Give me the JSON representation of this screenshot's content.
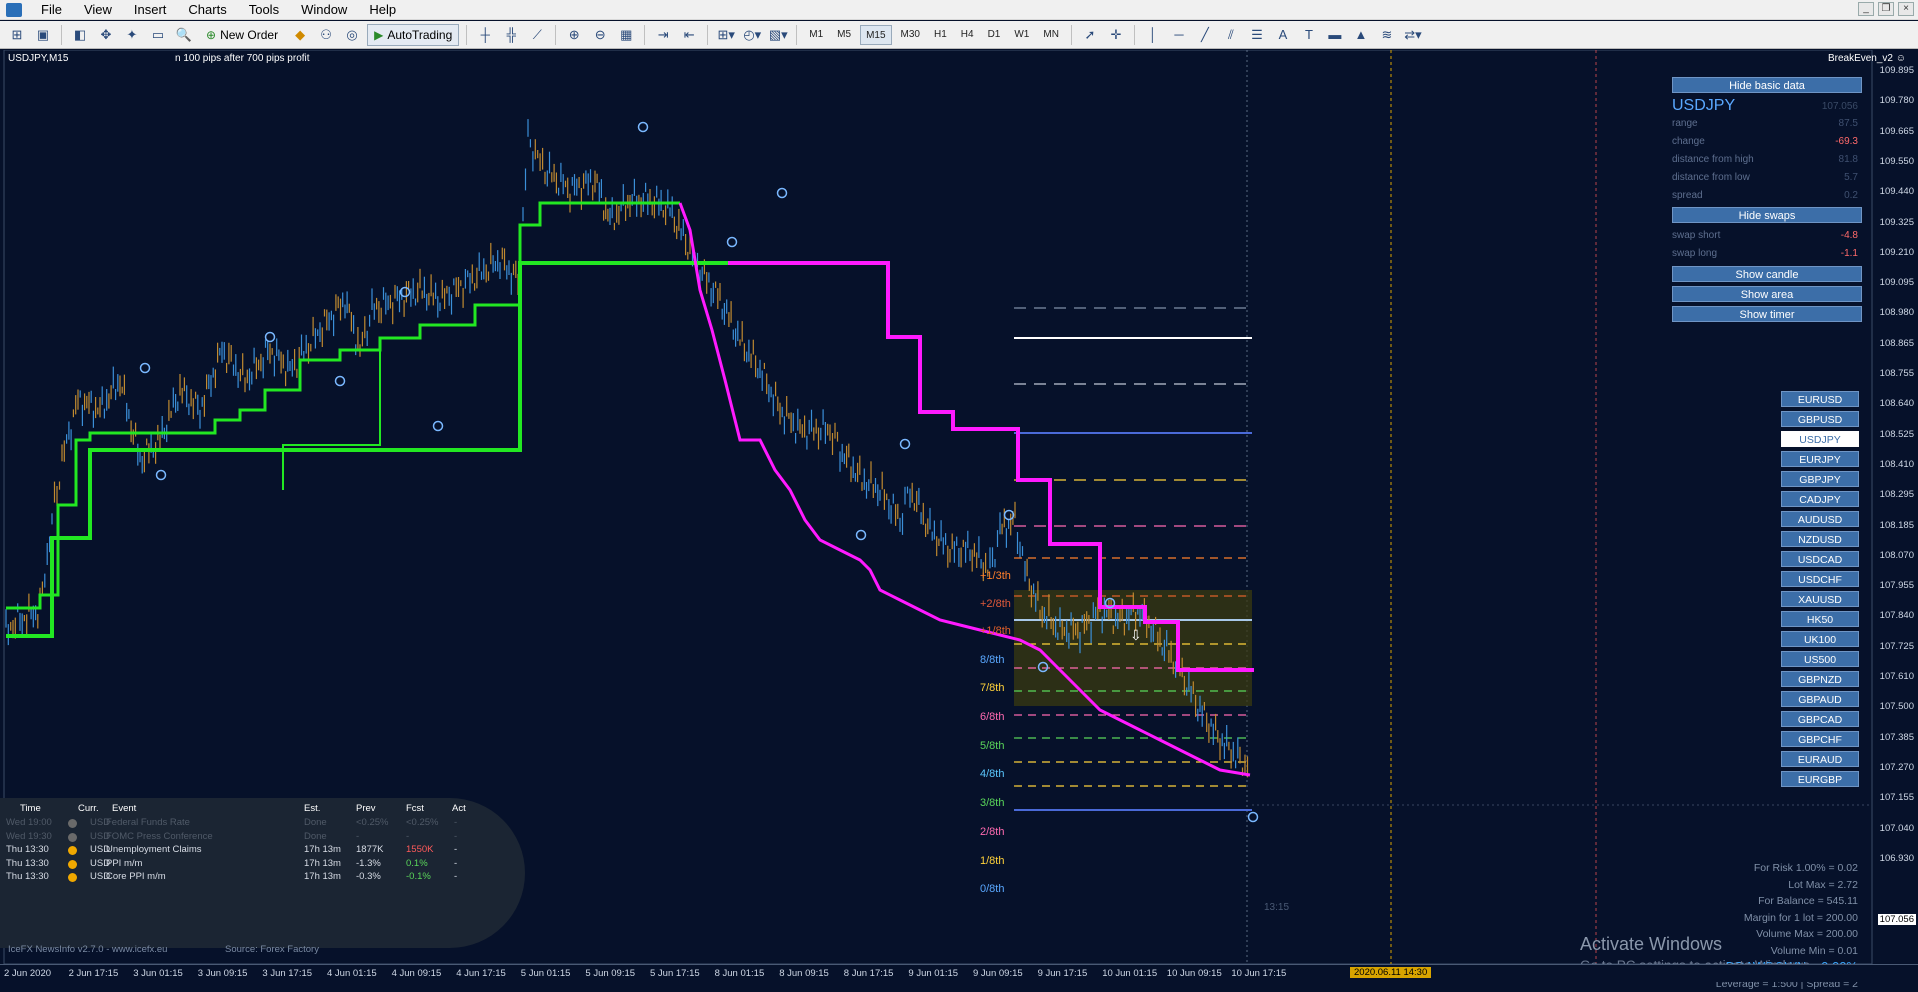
{
  "menu": [
    "File",
    "View",
    "Insert",
    "Charts",
    "Tools",
    "Window",
    "Help"
  ],
  "window_controls": [
    "_",
    "❐",
    "×"
  ],
  "toolbar": {
    "new_order": "New Order",
    "autotrading": "AutoTrading",
    "timeframes": [
      "M1",
      "M5",
      "M15",
      "M30",
      "H1",
      "H4",
      "D1",
      "W1",
      "MN"
    ],
    "active_timeframe": "M15"
  },
  "chart": {
    "symbol_title": "USDJPY,M15",
    "note": "n 100 pips after 700 pips profit",
    "indicator": "BreakEven_v2"
  },
  "price_axis": {
    "labels": [
      "109.895",
      "109.780",
      "109.665",
      "109.550",
      "109.440",
      "109.325",
      "109.210",
      "109.095",
      "108.980",
      "108.865",
      "108.755",
      "108.640",
      "108.525",
      "108.410",
      "108.295",
      "108.185",
      "108.070",
      "107.955",
      "107.840",
      "107.725",
      "107.610",
      "107.500",
      "107.385",
      "107.270",
      "107.155",
      "107.040",
      "106.930"
    ],
    "current": "107.056"
  },
  "time_axis": {
    "labels": [
      "2 Jun 2020",
      "2 Jun 17:15",
      "3 Jun 01:15",
      "3 Jun 09:15",
      "3 Jun 17:15",
      "4 Jun 01:15",
      "4 Jun 09:15",
      "4 Jun 17:15",
      "5 Jun 01:15",
      "5 Jun 09:15",
      "5 Jun 17:15",
      "8 Jun 01:15",
      "8 Jun 09:15",
      "8 Jun 17:15",
      "9 Jun 01:15",
      "9 Jun 09:15",
      "9 Jun 17:15",
      "10 Jun 01:15",
      "10 Jun 09:15",
      "10 Jun 17:15"
    ],
    "cursor": "2020.06.11 14:30"
  },
  "panel": {
    "hide_basic": "Hide basic data",
    "symbol": "USDJPY",
    "symbol_price": "107.056",
    "rows": [
      {
        "label": "range",
        "value": "87.5"
      },
      {
        "label": "change",
        "value": "-69.3"
      },
      {
        "label": "distance from high",
        "value": "81.8"
      },
      {
        "label": "distance from low",
        "value": "5.7"
      },
      {
        "label": "spread",
        "value": "0.2"
      }
    ],
    "hide_swaps": "Hide swaps",
    "swaps": [
      {
        "label": "swap short",
        "value": "-4.8"
      },
      {
        "label": "swap long",
        "value": "-1.1"
      }
    ],
    "show_candle": "Show candle",
    "show_area": "Show area",
    "show_timer": "Show timer"
  },
  "pairs": [
    "EURUSD",
    "GBPUSD",
    "USDJPY",
    "EURJPY",
    "GBPJPY",
    "CADJPY",
    "AUDUSD",
    "NZDUSD",
    "USDCAD",
    "USDCHF",
    "XAUUSD",
    "HK50",
    "UK100",
    "US500",
    "GBPNZD",
    "GBPAUD",
    "GBPCAD",
    "GBPCHF",
    "EURAUD",
    "EURGBP"
  ],
  "selected_pair": "USDJPY",
  "risk": {
    "lines": [
      "For Risk 1.00% = 0.02",
      "Lot Max = 2.72",
      "For Balance = 545.11",
      "Margin for 1 lot = 200.00",
      "Volume Max = 200.00",
      "Volume Min = 0.01"
    ],
    "drawdown": "DRAWDOWN = 0.00%",
    "leverage": "Leverage = 1:500 | Spread = 2"
  },
  "news": {
    "headers": [
      "Time",
      "Curr.",
      "Event",
      "Est.",
      "Prev",
      "Fcst",
      "Act"
    ],
    "rows": [
      {
        "time": "Wed 19:00",
        "curr": "USD",
        "event": "Federal Funds Rate",
        "est": "Done",
        "prev": "<0.25%",
        "fcst": "<0.25%",
        "act": "-",
        "dim": true
      },
      {
        "time": "Wed 19:30",
        "curr": "USD",
        "event": "FOMC Press Conference",
        "est": "Done",
        "prev": "-",
        "fcst": "-",
        "act": "-",
        "dim": true
      },
      {
        "time": "Thu 13:30",
        "curr": "USD",
        "event": "Unemployment Claims",
        "est": "17h 13m",
        "prev": "1877K",
        "fcst": "1550K",
        "act": "-",
        "dim": false
      },
      {
        "time": "Thu 13:30",
        "curr": "USD",
        "event": "PPI m/m",
        "est": "17h 13m",
        "prev": "-1.3%",
        "fcst": "0.1%",
        "act": "-",
        "dim": false
      },
      {
        "time": "Thu 13:30",
        "curr": "USD",
        "event": "Core PPI m/m",
        "est": "17h 13m",
        "prev": "-0.3%",
        "fcst": "-0.1%",
        "act": "-",
        "dim": false
      }
    ],
    "footer": "IceFX NewsInfo v2.7.0 - www.icefx.eu",
    "source": "Source: Forex Factory"
  },
  "murrey": [
    "+1/3th",
    "+2/8th",
    "+1/8th",
    "8/8th",
    "7/8th",
    "6/8th",
    "5/8th",
    "4/8th",
    "3/8th",
    "2/8th",
    "1/8th",
    "0/8th"
  ],
  "candle_timer": "13:15",
  "watermark": {
    "line1": "Activate Windows",
    "line2": "Go to PC settings to activate Windows."
  },
  "colors": {
    "green": "#22e822",
    "magenta": "#ff1aff",
    "bg": "#06112a"
  }
}
